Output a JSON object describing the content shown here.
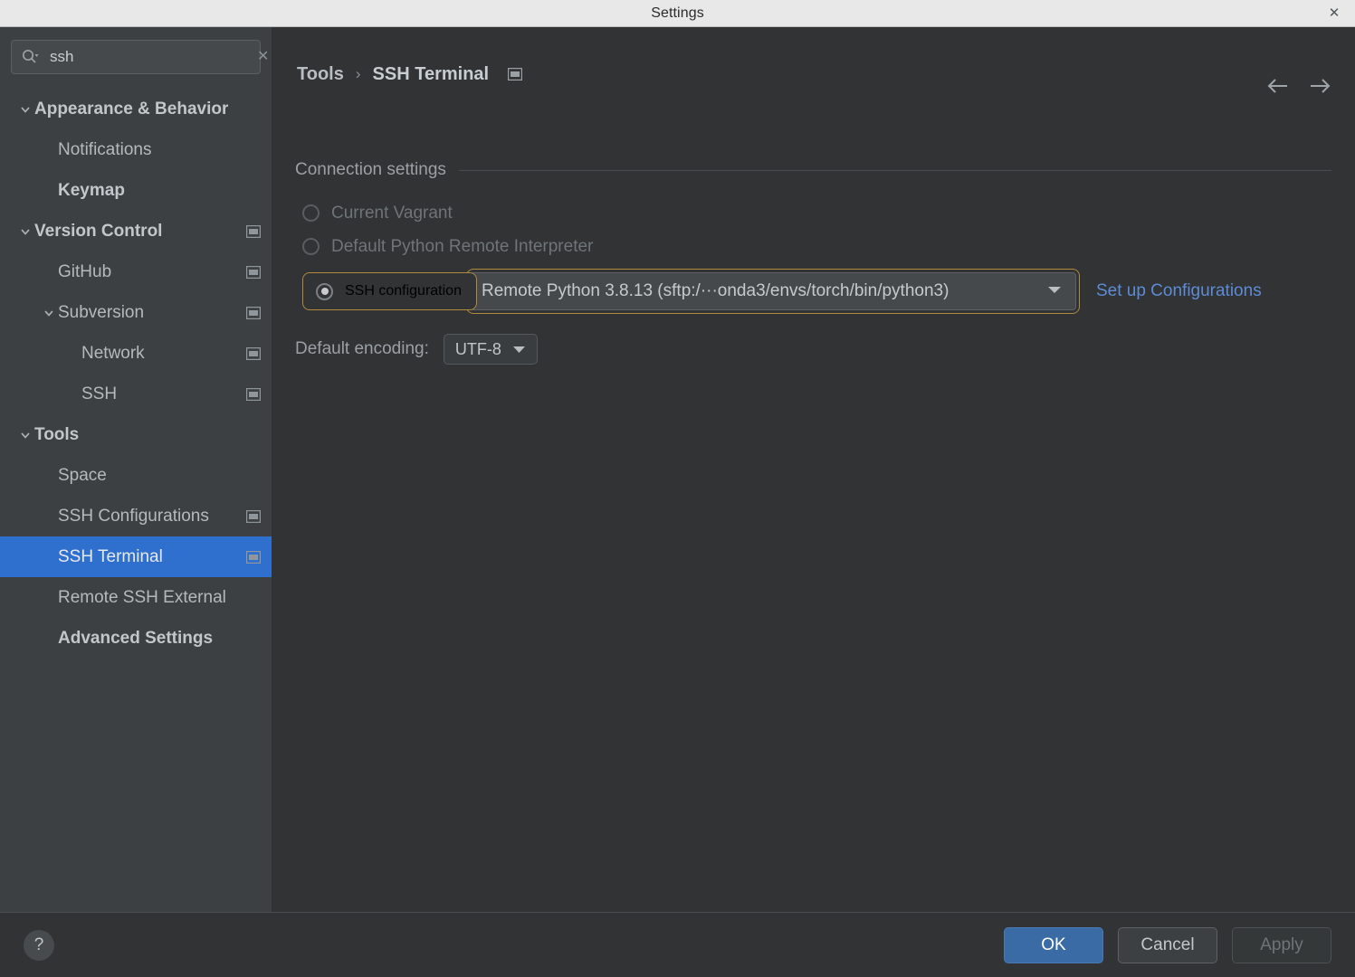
{
  "window": {
    "title": "Settings",
    "close_icon": "close-icon"
  },
  "sidebar": {
    "search": {
      "value": "ssh",
      "placeholder": "Search settings",
      "icon": "search-icon",
      "clear_icon": "clear-icon"
    },
    "items": [
      {
        "label": "Appearance & Behavior",
        "indent": 0,
        "expandable": true,
        "expanded": true,
        "bold": true,
        "badge": false,
        "selected": false
      },
      {
        "label": "Notifications",
        "indent": 1,
        "expandable": false,
        "expanded": false,
        "bold": false,
        "badge": false,
        "selected": false
      },
      {
        "label": "Keymap",
        "indent": 1,
        "expandable": false,
        "expanded": false,
        "bold": true,
        "badge": false,
        "selected": false
      },
      {
        "label": "Version Control",
        "indent": 0,
        "expandable": true,
        "expanded": true,
        "bold": true,
        "badge": true,
        "selected": false
      },
      {
        "label": "GitHub",
        "indent": 1,
        "expandable": false,
        "expanded": false,
        "bold": false,
        "badge": true,
        "selected": false
      },
      {
        "label": "Subversion",
        "indent": 2,
        "expandable": true,
        "expanded": true,
        "bold": false,
        "badge": true,
        "selected": false
      },
      {
        "label": "Network",
        "indent": 3,
        "expandable": false,
        "expanded": false,
        "bold": false,
        "badge": true,
        "selected": false
      },
      {
        "label": "SSH",
        "indent": 3,
        "expandable": false,
        "expanded": false,
        "bold": false,
        "badge": true,
        "selected": false
      },
      {
        "label": "Tools",
        "indent": 0,
        "expandable": true,
        "expanded": true,
        "bold": true,
        "badge": false,
        "selected": false
      },
      {
        "label": "Space",
        "indent": 1,
        "expandable": false,
        "expanded": false,
        "bold": false,
        "badge": false,
        "selected": false
      },
      {
        "label": "SSH Configurations",
        "indent": 1,
        "expandable": false,
        "expanded": false,
        "bold": false,
        "badge": true,
        "selected": false
      },
      {
        "label": "SSH Terminal",
        "indent": 1,
        "expandable": false,
        "expanded": false,
        "bold": false,
        "badge": true,
        "selected": true
      },
      {
        "label": "Remote SSH External",
        "indent": 1,
        "expandable": false,
        "expanded": false,
        "bold": false,
        "badge": false,
        "selected": false
      },
      {
        "label": "Advanced Settings",
        "indent": 1,
        "expandable": false,
        "expanded": false,
        "bold": true,
        "badge": false,
        "selected": false
      }
    ]
  },
  "breadcrumb": {
    "parent": "Tools",
    "separator": "›",
    "current": "SSH Terminal",
    "badge_icon": "mini-window-icon"
  },
  "nav": {
    "back_icon": "arrow-left-icon",
    "forward_icon": "arrow-right-icon"
  },
  "main": {
    "section_title": "Connection settings",
    "options": [
      {
        "label": "Current Vagrant",
        "checked": false,
        "disabled": true
      },
      {
        "label": "Default Python Remote Interpreter",
        "checked": false,
        "disabled": true
      }
    ],
    "ssh_config": {
      "label": "SSH configuration",
      "checked": true,
      "dropdown_value": "Remote Python 3.8.13 (sftp:/···onda3/envs/torch/bin/python3)",
      "dropdown_icon": "chevron-down-icon",
      "link_label": "Set up Configurations"
    },
    "encoding": {
      "label": "Default encoding:",
      "value": "UTF-8",
      "dropdown_icon": "chevron-down-icon"
    }
  },
  "footer": {
    "help_icon": "help-icon",
    "help_label": "?",
    "ok_label": "OK",
    "cancel_label": "Cancel",
    "apply_label": "Apply"
  },
  "colors": {
    "accent_selection": "#2f6fce",
    "primary_button": "#3b6ba5",
    "focus_ring": "#b08a3e",
    "link": "#5d8bd4",
    "sidebar_bg": "#3c4043",
    "main_bg": "#313335",
    "titlebar_bg": "#e8e8e8"
  }
}
